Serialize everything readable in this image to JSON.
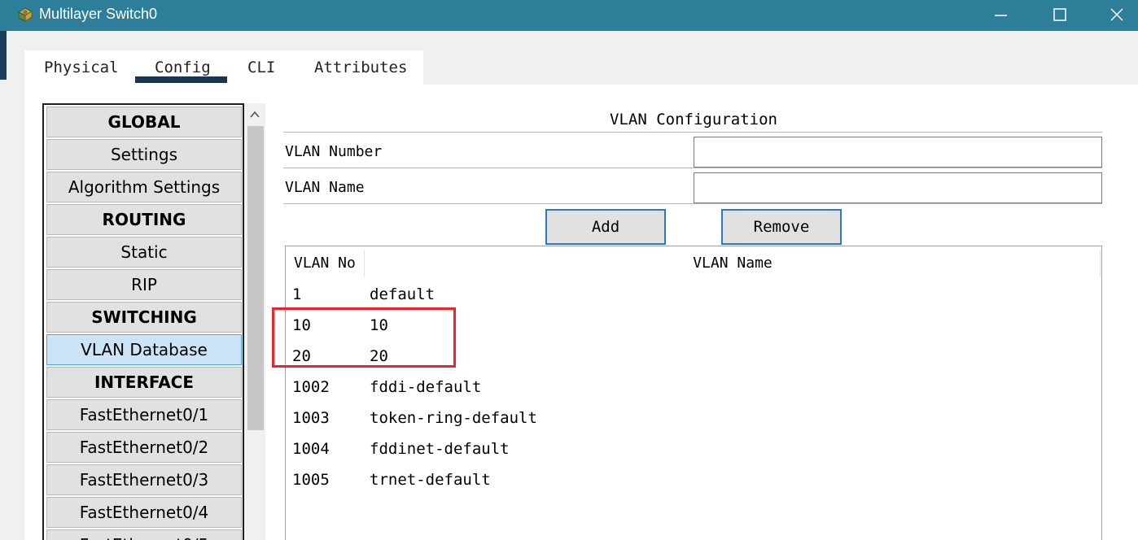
{
  "window": {
    "title": "Multilayer Switch0",
    "controls": {
      "minimize": "minimize",
      "maximize": "maximize",
      "close": "close"
    }
  },
  "tabs": [
    {
      "label": "Physical"
    },
    {
      "label": "Config",
      "active": true
    },
    {
      "label": "CLI"
    },
    {
      "label": "Attributes"
    }
  ],
  "nav": {
    "items": [
      {
        "label": "GLOBAL",
        "type": "header"
      },
      {
        "label": "Settings",
        "type": "item"
      },
      {
        "label": "Algorithm Settings",
        "type": "item"
      },
      {
        "label": "ROUTING",
        "type": "header"
      },
      {
        "label": "Static",
        "type": "item"
      },
      {
        "label": "RIP",
        "type": "item"
      },
      {
        "label": "SWITCHING",
        "type": "header"
      },
      {
        "label": "VLAN Database",
        "type": "item",
        "selected": true
      },
      {
        "label": "INTERFACE",
        "type": "header"
      },
      {
        "label": "FastEthernet0/1",
        "type": "item"
      },
      {
        "label": "FastEthernet0/2",
        "type": "item"
      },
      {
        "label": "FastEthernet0/3",
        "type": "item"
      },
      {
        "label": "FastEthernet0/4",
        "type": "item"
      },
      {
        "label": "FastEthernet0/5",
        "type": "item"
      }
    ]
  },
  "vlan_config": {
    "title": "VLAN Configuration",
    "number_label": "VLAN Number",
    "number_value": "",
    "name_label": "VLAN Name",
    "name_value": "",
    "add_label": "Add",
    "remove_label": "Remove",
    "table": {
      "headers": {
        "no": "VLAN No",
        "name": "VLAN Name"
      },
      "rows": [
        {
          "no": "1",
          "name": "default"
        },
        {
          "no": "10",
          "name": "10"
        },
        {
          "no": "20",
          "name": "20"
        },
        {
          "no": "1002",
          "name": "fddi-default"
        },
        {
          "no": "1003",
          "name": "token-ring-default"
        },
        {
          "no": "1004",
          "name": "fddinet-default"
        },
        {
          "no": "1005",
          "name": "trnet-default"
        }
      ]
    }
  },
  "colors": {
    "titlebar": "#2d7f99",
    "tab_underline": "#1a3550",
    "selected_nav": "#cce4f7",
    "button_border": "#2b7bbf",
    "annotation_box": "#e8252a"
  },
  "icons": [
    "app-switch-icon",
    "minimize-icon",
    "maximize-icon",
    "close-icon",
    "scroll-up-icon"
  ]
}
